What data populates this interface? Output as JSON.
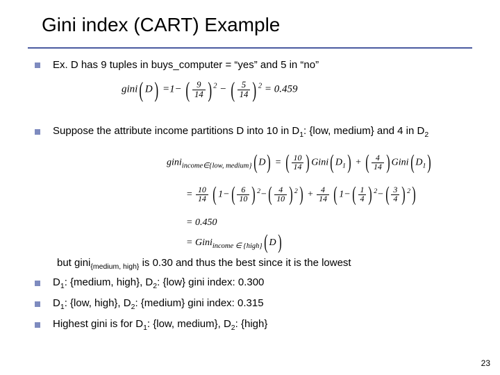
{
  "title": "Gini index (CART) Example",
  "page_number": "23",
  "bullets": {
    "b1_prefix": "Ex.  D has 9 tuples in buys_computer = “yes” and 5 in “no”",
    "b2_a": "Suppose the attribute income partitions D into 10 in D",
    "b2_b": ": {low, medium} and 4 in D",
    "b2_s1": "1",
    "b2_s2": "2",
    "but_a": "but gini",
    "but_sub": "{medium, high}",
    "but_b": " is 0.30 and thus the best since it is the lowest",
    "b3_a": "D",
    "b3_b": ": {medium, high}, D",
    "b3_c": ": {low} gini index: 0.300",
    "b4_a": "D",
    "b4_b": ": {low, high}, D",
    "b4_c": ": {medium} gini index: 0.315",
    "b5_a": "Highest gini is for D",
    "b5_b": ": {low, medium}, D",
    "b5_c": ": {high}"
  },
  "eq": {
    "gini_label": "gini",
    "D": "D",
    "D1": "D",
    "D2": "D",
    "Gini": "Gini",
    "one": "1",
    "two": "2",
    "sub_inc_lm": "income∈{low, medium}",
    "sub_inc_high": "income ∈ {high}",
    "f9": "9",
    "f14": "14",
    "f5": "5",
    "f10": "10",
    "f4": "4",
    "f6": "6",
    "f1_": "1",
    "f3": "3",
    "res1": "0.459",
    "res4": "0.450",
    "eq_sign": "=",
    "minus": "−",
    "plus": "+",
    "lp": "(",
    "rp": ")"
  }
}
